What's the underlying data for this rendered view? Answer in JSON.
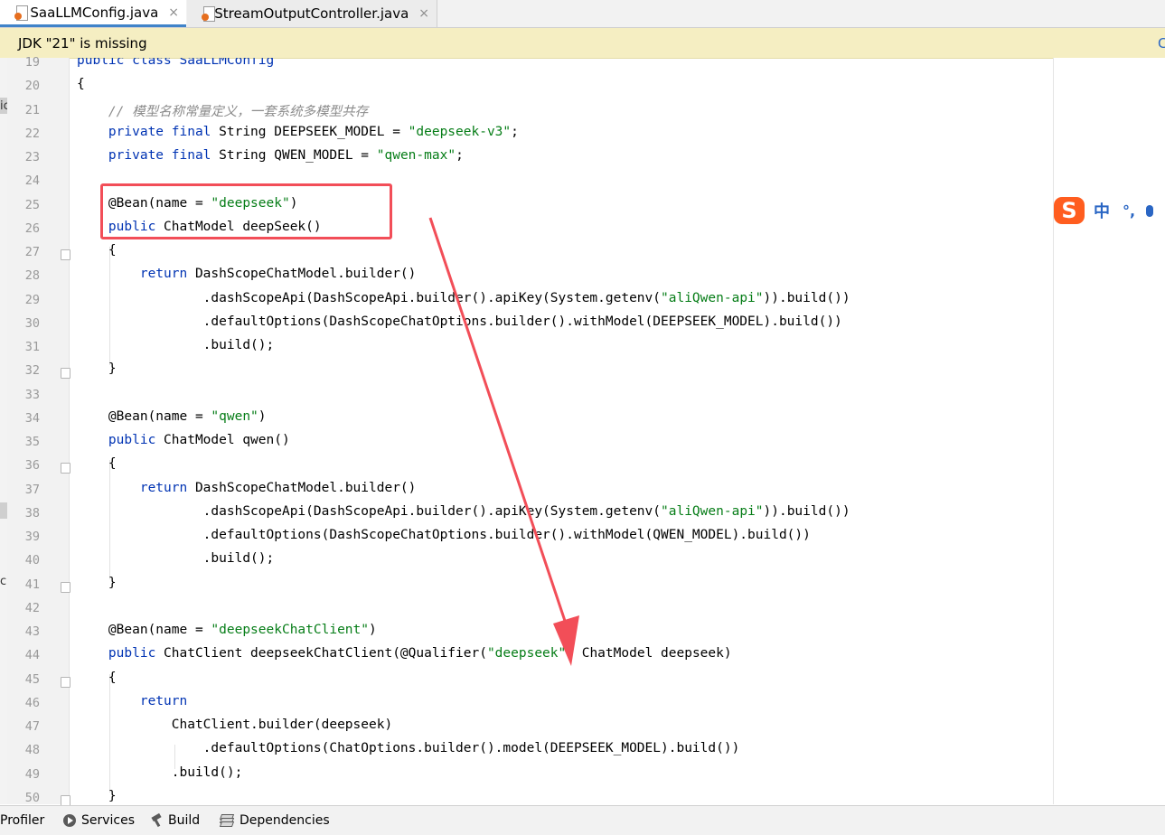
{
  "tabs": [
    {
      "label": "SaaLLMConfig.java",
      "active": true,
      "icon": "java-file-icon",
      "close": "×"
    },
    {
      "label": "StreamOutputController.java",
      "active": false,
      "icon": "java-file-icon",
      "close": "×"
    }
  ],
  "notification": {
    "message": "JDK \"21\" is missing",
    "action_partial": "C"
  },
  "left_chars": [
    "ic",
    "c"
  ],
  "line_numbers": [
    "19",
    "20",
    "21",
    "22",
    "23",
    "24",
    "25",
    "26",
    "27",
    "28",
    "29",
    "30",
    "31",
    "32",
    "33",
    "34",
    "35",
    "36",
    "37",
    "38",
    "39",
    "40",
    "41",
    "42",
    "43",
    "44",
    "45",
    "46",
    "47",
    "48",
    "49",
    "50"
  ],
  "code_lines": [
    [
      {
        "t": "public class SaaLLMConfig",
        "c": "kw"
      }
    ],
    [
      {
        "t": "{",
        "c": ""
      }
    ],
    [
      {
        "t": "    ",
        "c": ""
      },
      {
        "t": "// 模型名称常量定义，一套系统多模型共存",
        "c": "cm"
      }
    ],
    [
      {
        "t": "    ",
        "c": ""
      },
      {
        "t": "private final ",
        "c": "kw"
      },
      {
        "t": "String DEEPSEEK_MODEL = ",
        "c": ""
      },
      {
        "t": "\"deepseek-v3\"",
        "c": "str"
      },
      {
        "t": ";",
        "c": ""
      }
    ],
    [
      {
        "t": "    ",
        "c": ""
      },
      {
        "t": "private final ",
        "c": "kw"
      },
      {
        "t": "String QWEN_MODEL = ",
        "c": ""
      },
      {
        "t": "\"qwen-max\"",
        "c": "str"
      },
      {
        "t": ";",
        "c": ""
      }
    ],
    [
      {
        "t": "",
        "c": ""
      }
    ],
    [
      {
        "t": "    @Bean(name = ",
        "c": ""
      },
      {
        "t": "\"deepseek\"",
        "c": "str"
      },
      {
        "t": ")",
        "c": ""
      }
    ],
    [
      {
        "t": "    ",
        "c": ""
      },
      {
        "t": "public ",
        "c": "kw"
      },
      {
        "t": "ChatModel deepSeek()",
        "c": ""
      }
    ],
    [
      {
        "t": "    {",
        "c": ""
      }
    ],
    [
      {
        "t": "        ",
        "c": ""
      },
      {
        "t": "return ",
        "c": "kw"
      },
      {
        "t": "DashScopeChatModel.builder()",
        "c": ""
      }
    ],
    [
      {
        "t": "                .dashScopeApi(DashScopeApi.builder().apiKey(System.getenv(",
        "c": ""
      },
      {
        "t": "\"aliQwen-api\"",
        "c": "str"
      },
      {
        "t": ")).build())",
        "c": ""
      }
    ],
    [
      {
        "t": "                .defaultOptions(DashScopeChatOptions.builder().withModel(DEEPSEEK_MODEL).build())",
        "c": ""
      }
    ],
    [
      {
        "t": "                .build();",
        "c": ""
      }
    ],
    [
      {
        "t": "    }",
        "c": ""
      }
    ],
    [
      {
        "t": "",
        "c": ""
      }
    ],
    [
      {
        "t": "    @Bean(name = ",
        "c": ""
      },
      {
        "t": "\"qwen\"",
        "c": "str"
      },
      {
        "t": ")",
        "c": ""
      }
    ],
    [
      {
        "t": "    ",
        "c": ""
      },
      {
        "t": "public ",
        "c": "kw"
      },
      {
        "t": "ChatModel qwen()",
        "c": ""
      }
    ],
    [
      {
        "t": "    {",
        "c": ""
      }
    ],
    [
      {
        "t": "        ",
        "c": ""
      },
      {
        "t": "return ",
        "c": "kw"
      },
      {
        "t": "DashScopeChatModel.builder()",
        "c": ""
      }
    ],
    [
      {
        "t": "                .dashScopeApi(DashScopeApi.builder().apiKey(System.getenv(",
        "c": ""
      },
      {
        "t": "\"aliQwen-api\"",
        "c": "str"
      },
      {
        "t": ")).build())",
        "c": ""
      }
    ],
    [
      {
        "t": "                .defaultOptions(DashScopeChatOptions.builder().withModel(QWEN_MODEL).build())",
        "c": ""
      }
    ],
    [
      {
        "t": "                .build();",
        "c": ""
      }
    ],
    [
      {
        "t": "    }",
        "c": ""
      }
    ],
    [
      {
        "t": "",
        "c": ""
      }
    ],
    [
      {
        "t": "    @Bean(name = ",
        "c": ""
      },
      {
        "t": "\"deepseekChatClient\"",
        "c": "str"
      },
      {
        "t": ")",
        "c": ""
      }
    ],
    [
      {
        "t": "    ",
        "c": ""
      },
      {
        "t": "public ",
        "c": "kw"
      },
      {
        "t": "ChatClient deepseekChatClient(@Qualifier(",
        "c": ""
      },
      {
        "t": "\"deepseek\"",
        "c": "str"
      },
      {
        "t": ") ChatModel deepseek)",
        "c": ""
      }
    ],
    [
      {
        "t": "    {",
        "c": ""
      }
    ],
    [
      {
        "t": "        ",
        "c": ""
      },
      {
        "t": "return",
        "c": "kw"
      }
    ],
    [
      {
        "t": "            ChatClient.builder(deepseek)",
        "c": ""
      }
    ],
    [
      {
        "t": "                .defaultOptions(ChatOptions.builder().model(DEEPSEEK_MODEL).build())",
        "c": ""
      }
    ],
    [
      {
        "t": "            .build();",
        "c": ""
      }
    ],
    [
      {
        "t": "    }",
        "c": ""
      }
    ]
  ],
  "fold_markers": [
    "27",
    "32",
    "36",
    "41",
    "45",
    "50"
  ],
  "ime": {
    "logo": "S",
    "mode": "中",
    "punct": "°,",
    "icon": "microphone-icon"
  },
  "annotation": {
    "box_color": "#f24e58",
    "arrow_color": "#f24e58"
  },
  "colors": {
    "keyword": "#0033b3",
    "string": "#067d17",
    "comment": "#8c8c8c",
    "notice_bg": "#f5eec2",
    "tab_underline": "#4083c9"
  },
  "bottom_tools": [
    {
      "label": "Profiler",
      "icon": ""
    },
    {
      "label": "Services",
      "icon": "services-icon"
    },
    {
      "label": "Build",
      "icon": "hammer-icon"
    },
    {
      "label": "Dependencies",
      "icon": "dependencies-icon"
    }
  ]
}
